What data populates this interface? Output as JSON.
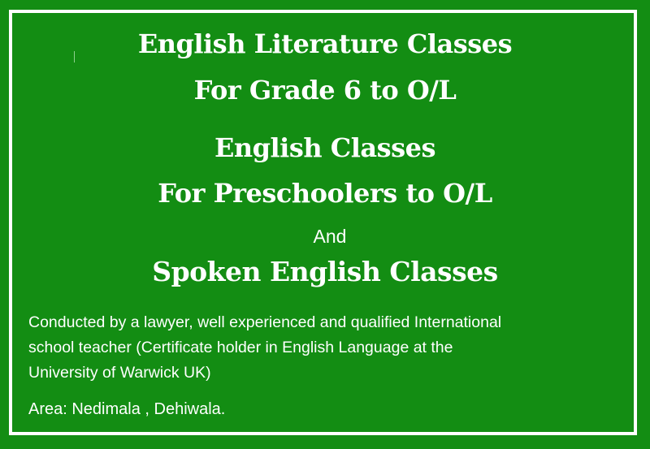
{
  "headings": {
    "line1": "English Literature Classes",
    "line2": "For Grade 6 to O/L",
    "line3": "English Classes",
    "line4": "For Preschoolers to O/L",
    "connector": "And",
    "line5": "Spoken English Classes"
  },
  "description": {
    "line1": "Conducted by a lawyer, well experienced and qualified International",
    "line2": "school teacher (Certificate holder in English Language at the",
    "line3": "University of Warwick UK)"
  },
  "area": "Area: Nedimala , Dehiwala.",
  "colors": {
    "background": "#138d13",
    "border": "#ffffff",
    "text": "#ffffff"
  }
}
